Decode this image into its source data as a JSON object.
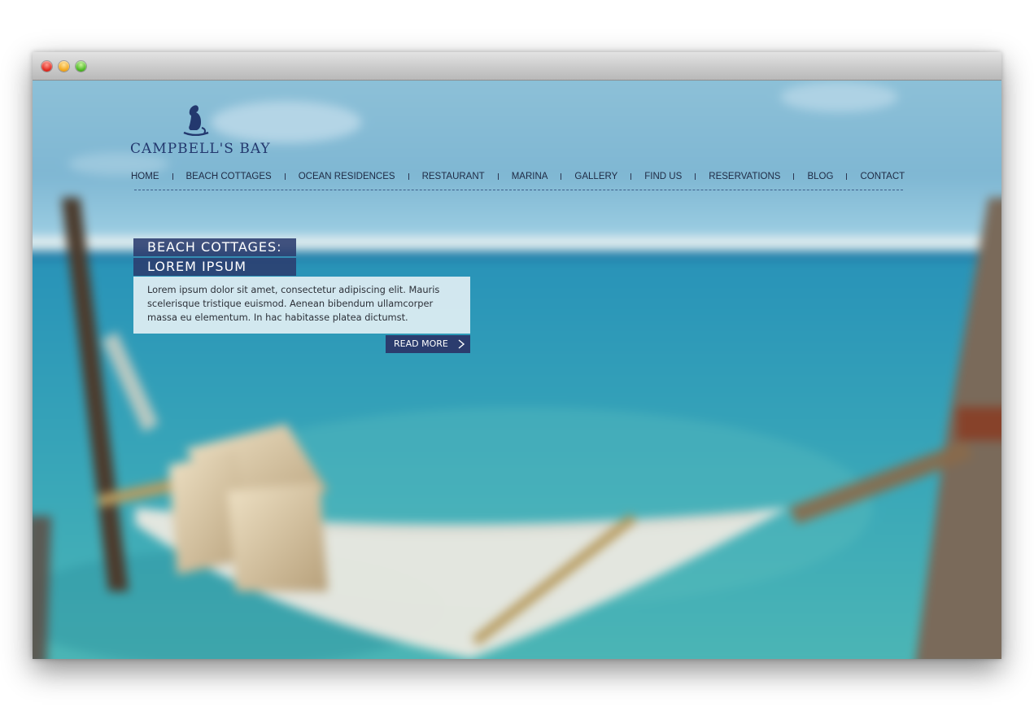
{
  "window": {
    "controls": [
      "close-button",
      "minimize-button",
      "zoom-button"
    ]
  },
  "brand": {
    "name": "CAMPBELL'S BAY",
    "color": "#23386e"
  },
  "nav": {
    "items": [
      {
        "label": "HOME"
      },
      {
        "label": "BEACH COTTAGES"
      },
      {
        "label": "OCEAN RESIDENCES"
      },
      {
        "label": "RESTAURANT"
      },
      {
        "label": "MARINA"
      },
      {
        "label": "GALLERY"
      },
      {
        "label": "FIND US"
      },
      {
        "label": "RESERVATIONS"
      },
      {
        "label": "BLOG"
      },
      {
        "label": "CONTACT"
      }
    ]
  },
  "feature": {
    "headline_line1": "BEACH COTTAGES:",
    "headline_line2": "LOREM IPSUM",
    "body": "Lorem ipsum dolor sit amet, consectetur adipiscing elit. Mauris scelerisque tristique euismod. Aenean bibendum ullamcorper massa eu elementum. In hac habitasse platea dictumst.",
    "cta_label": "READ MORE",
    "cta_icon": "chevron-right-icon",
    "accent_color": "#2b3c6e"
  },
  "background": {
    "subject": "hammock-over-ocean-photo"
  }
}
